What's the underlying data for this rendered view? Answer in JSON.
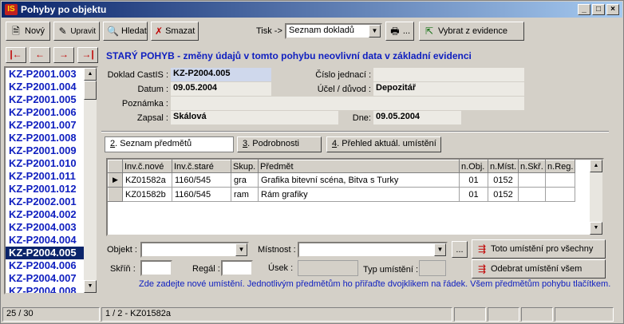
{
  "window": {
    "title": "Pohyby po objektu",
    "logo": "IS"
  },
  "toolbar": {
    "new_label": "Nový",
    "edit_label": "Upravit",
    "find_label": "Hledat",
    "delete_label": "Smazat",
    "print_label": "Tisk ->",
    "print_select": "Seznam dokladů",
    "print_button": "...",
    "choose_label": "Vybrat z evidence"
  },
  "records": {
    "items": [
      "KZ-P2001.003",
      "KZ-P2001.004",
      "KZ-P2001.005",
      "KZ-P2001.006",
      "KZ-P2001.007",
      "KZ-P2001.008",
      "KZ-P2001.009",
      "KZ-P2001.010",
      "KZ-P2001.011",
      "KZ-P2001.012",
      "KZ-P2002.001",
      "KZ-P2004.002",
      "KZ-P2004.003",
      "KZ-P2004.004",
      "KZ-P2004.005",
      "KZ-P2004.006",
      "KZ-P2004.007",
      "KZ-P2004.008"
    ],
    "selected_index": 14
  },
  "form": {
    "heading": "STARÝ POHYB - změny údajů v tomto pohybu neovlivní data v základní evidenci",
    "doklad_label": "Doklad CastIS :",
    "doklad_value": "KZ-P2004.005",
    "cislo_label": "Číslo jednací :",
    "cislo_value": "",
    "datum_label": "Datum :",
    "datum_value": "09.05.2004",
    "ucel_label": "Účel / důvod :",
    "ucel_value": "Depozitář",
    "poznamka_label": "Poznámka :",
    "poznamka_value": "",
    "zapsal_label": "Zapsal :",
    "zapsal_value": "Skálová",
    "dne_label": "Dne:",
    "dne_value": "09.05.2004"
  },
  "tabs": [
    {
      "num": "2",
      "text": ". Seznam předmětů"
    },
    {
      "num": "3",
      "text": ". Podrobnosti"
    },
    {
      "num": "4",
      "text": ". Přehled aktuál. umístění"
    }
  ],
  "grid": {
    "columns": [
      "Inv.č.nové",
      "Inv.č.staré",
      "Skup.",
      "Předmět",
      "n.Obj.",
      "n.Míst.",
      "n.Skř.",
      "n.Reg."
    ],
    "rows": [
      {
        "cells": [
          "KZ01582a",
          "1160/545",
          "gra",
          "Grafika bitevní scéna, Bitva s Turky",
          "01",
          "0152",
          "",
          ""
        ]
      },
      {
        "cells": [
          "KZ01582b",
          "1160/545",
          "ram",
          "Rám grafiky",
          "01",
          "0152",
          "",
          ""
        ]
      }
    ]
  },
  "bottom": {
    "objekt_label": "Objekt :",
    "mistnost_label": "Místnost :",
    "dots": "...",
    "set_all_button": "Toto umístění pro všechny",
    "remove_button": "Odebrat umístění všem",
    "skrin_label": "Skříň :",
    "regal_label": "Regál :",
    "usek_label": "Úsek :",
    "typ_label": "Typ umístění :",
    "hint": "Zde zadejte nové umístění.  Jednotlivým předmětům ho přiřaďte dvojklikem na řádek. Všem předmětům pohybu tlačítkem."
  },
  "status": {
    "position": "25 / 30",
    "detail": "1 / 2 - KZ01582a"
  }
}
